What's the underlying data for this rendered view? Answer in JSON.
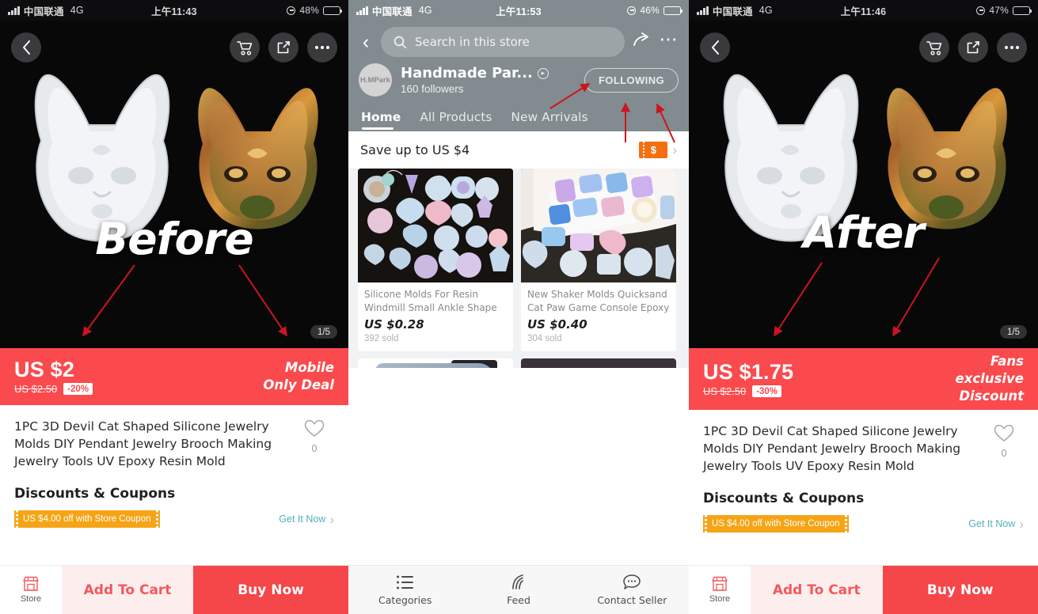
{
  "panels": {
    "left": {
      "status": {
        "carrier": "中国联通",
        "network": "4G",
        "time": "上午11:43",
        "battery": "48%"
      },
      "overlay_label": "Before",
      "image_counter": "1/5",
      "price": {
        "current": "US $2",
        "original": "US $2.50",
        "discount": "-20%",
        "deal_line1": "Mobile",
        "deal_line2": "Only Deal"
      },
      "product_title": "1PC 3D Devil Cat Shaped Silicone Jewelry Molds DIY Pendant Jewelry Brooch Making Jewelry Tools UV Epoxy Resin Mold",
      "wishlist_count": "0",
      "discounts_heading": "Discounts & Coupons",
      "coupon_text": "US $4.00 off with Store Coupon",
      "get_it_now": "Get It Now",
      "actions": {
        "store": "Store",
        "add_to_cart": "Add To Cart",
        "buy_now": "Buy Now"
      }
    },
    "middle": {
      "status": {
        "carrier": "中国联通",
        "network": "4G",
        "time": "上午11:53",
        "battery": "46%"
      },
      "search_placeholder": "Search in this store",
      "store": {
        "avatar_text": "H.MPark",
        "name": "Handmade Par...",
        "followers": "160  followers",
        "follow_button": "FOLLOWING"
      },
      "tabs": [
        {
          "label": "Home",
          "active": true
        },
        {
          "label": "All Products",
          "active": false
        },
        {
          "label": "New Arrivals",
          "active": false
        }
      ],
      "save_bar": {
        "text": "Save up to US $4",
        "badge": "$"
      },
      "products": [
        {
          "title": "Silicone Molds For Resin Windmill Small Ankle Shape UV ...",
          "price": "US $0.28",
          "sold": "392 sold"
        },
        {
          "title": "New Shaker Molds Quicksand Cat Paw Game Console Epoxy ...",
          "price": "US $0.40",
          "sold": "304 sold"
        }
      ],
      "bottom_nav": [
        {
          "label": "Categories",
          "icon": "list-icon"
        },
        {
          "label": "Feed",
          "icon": "feed-icon"
        },
        {
          "label": "Contact Seller",
          "icon": "chat-icon"
        }
      ]
    },
    "right": {
      "status": {
        "carrier": "中国联通",
        "network": "4G",
        "time": "上午11:46",
        "battery": "47%"
      },
      "overlay_label": "After",
      "image_counter": "1/5",
      "price": {
        "current": "US $1.75",
        "original": "US $2.50",
        "discount": "-30%",
        "deal_line1": "Fans",
        "deal_line2": "exclusive",
        "deal_line3": "Discount"
      },
      "product_title": "1PC 3D Devil Cat Shaped Silicone Jewelry Molds DIY Pendant Jewelry Brooch Making Jewelry Tools UV Epoxy Resin Mold",
      "wishlist_count": "0",
      "discounts_heading": "Discounts & Coupons",
      "coupon_text": "US $4.00 off with Store Coupon",
      "get_it_now": "Get It Now",
      "actions": {
        "store": "Store",
        "add_to_cart": "Add To Cart",
        "buy_now": "Buy Now"
      }
    }
  },
  "colors": {
    "price_banner_red": "#fa4a4d",
    "buy_now_red": "#f5464a",
    "add_cart_bg": "#fdeeee",
    "coupon_orange": "#f5a416",
    "ticket_orange": "#f2700f",
    "store_header_gray": "#828b8f",
    "annotation_red": "#cc1520",
    "teal_link": "#50b0b8"
  }
}
